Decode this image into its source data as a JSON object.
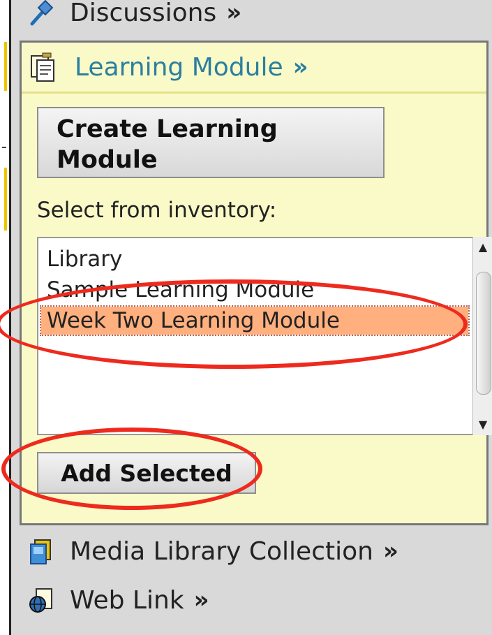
{
  "sidebar": {
    "discussions_label": "Discussions",
    "chevron": "»",
    "learning_module": {
      "title": "Learning Module",
      "create_button_label": "Create Learning Module",
      "select_label": "Select from inventory:",
      "inventory_items": [
        "Library",
        "Sample Learning Module",
        "Week Two Learning Module"
      ],
      "selected_item": "Week Two Learning Module",
      "add_button_label": "Add Selected"
    },
    "media_library_label": "Media Library Collection",
    "web_link_label": "Web Link"
  },
  "colors": {
    "panel_background": "#fafac8",
    "header_text": "#2a7fa0",
    "selection_highlight": "#ffb07e",
    "annotation_red": "#ee2a1e"
  },
  "icons": [
    "pin-icon",
    "document-icon",
    "media-library-icon",
    "web-link-icon"
  ]
}
